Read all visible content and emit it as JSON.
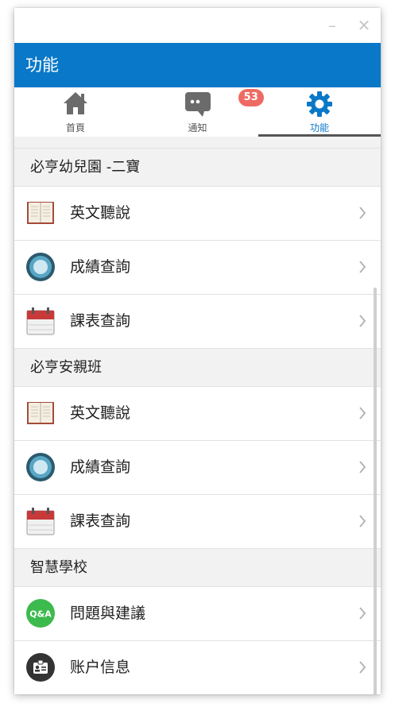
{
  "window": {
    "minimize_glyph": "–",
    "close_glyph": "✕"
  },
  "header": {
    "title": "功能"
  },
  "tabs": [
    {
      "label": "首頁",
      "icon": "home-icon",
      "active": false
    },
    {
      "label": "通知",
      "icon": "chat-icon",
      "badge": "53",
      "active": false
    },
    {
      "label": "功能",
      "icon": "gear-icon",
      "active": true
    }
  ],
  "sections": [
    {
      "title": "必亨幼兒園 -二寶",
      "items": [
        {
          "label": "英文聽說",
          "icon": "book-icon"
        },
        {
          "label": "成績查詢",
          "icon": "circle-target-icon"
        },
        {
          "label": "課表查詢",
          "icon": "calendar-icon"
        }
      ]
    },
    {
      "title": "必亨安親班",
      "items": [
        {
          "label": "英文聽說",
          "icon": "book-icon"
        },
        {
          "label": "成績查詢",
          "icon": "circle-target-icon"
        },
        {
          "label": "課表查詢",
          "icon": "calendar-icon"
        }
      ]
    },
    {
      "title": "智慧學校",
      "items": [
        {
          "label": "問題與建議",
          "icon": "qa-icon",
          "icon_text": "Q&A"
        },
        {
          "label": "账户信息",
          "icon": "id-card-icon"
        }
      ]
    }
  ],
  "colors": {
    "brand": "#0a78c8",
    "badge": "#ee6b63",
    "qa_green": "#3dba4e",
    "section_bg": "#f2f2f2"
  }
}
